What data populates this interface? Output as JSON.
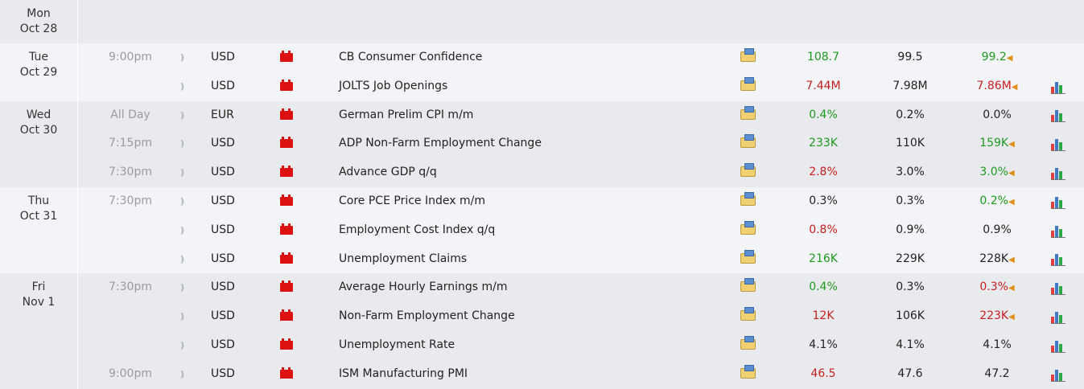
{
  "days": [
    {
      "day": "Mon",
      "date": "Oct 28",
      "events": []
    },
    {
      "day": "Tue",
      "date": "Oct 29",
      "events": [
        {
          "time": "9:00pm",
          "currency": "USD",
          "event": "CB Consumer Confidence",
          "actual": "108.7",
          "actual_color": "green",
          "forecast": "99.5",
          "previous": "99.2",
          "previous_color": "green",
          "revised": true,
          "chart": false
        },
        {
          "time": "",
          "currency": "USD",
          "event": "JOLTS Job Openings",
          "actual": "7.44M",
          "actual_color": "red",
          "forecast": "7.98M",
          "previous": "7.86M",
          "previous_color": "red",
          "revised": true,
          "chart": true
        }
      ]
    },
    {
      "day": "Wed",
      "date": "Oct 30",
      "events": [
        {
          "time": "All Day",
          "currency": "EUR",
          "event": "German Prelim CPI m/m",
          "actual": "0.4%",
          "actual_color": "green",
          "forecast": "0.2%",
          "previous": "0.0%",
          "previous_color": "dark",
          "revised": false,
          "chart": true
        },
        {
          "time": "7:15pm",
          "currency": "USD",
          "event": "ADP Non-Farm Employment Change",
          "actual": "233K",
          "actual_color": "green",
          "forecast": "110K",
          "previous": "159K",
          "previous_color": "green",
          "revised": true,
          "chart": true
        },
        {
          "time": "7:30pm",
          "currency": "USD",
          "event": "Advance GDP q/q",
          "actual": "2.8%",
          "actual_color": "red",
          "forecast": "3.0%",
          "previous": "3.0%",
          "previous_color": "green",
          "revised": true,
          "chart": true
        }
      ]
    },
    {
      "day": "Thu",
      "date": "Oct 31",
      "events": [
        {
          "time": "7:30pm",
          "currency": "USD",
          "event": "Core PCE Price Index m/m",
          "actual": "0.3%",
          "actual_color": "dark",
          "forecast": "0.3%",
          "previous": "0.2%",
          "previous_color": "green",
          "revised": true,
          "chart": true
        },
        {
          "time": "",
          "currency": "USD",
          "event": "Employment Cost Index q/q",
          "actual": "0.8%",
          "actual_color": "red",
          "forecast": "0.9%",
          "previous": "0.9%",
          "previous_color": "dark",
          "revised": false,
          "chart": true
        },
        {
          "time": "",
          "currency": "USD",
          "event": "Unemployment Claims",
          "actual": "216K",
          "actual_color": "green",
          "forecast": "229K",
          "previous": "228K",
          "previous_color": "dark",
          "revised": true,
          "chart": true
        }
      ]
    },
    {
      "day": "Fri",
      "date": "Nov 1",
      "events": [
        {
          "time": "7:30pm",
          "currency": "USD",
          "event": "Average Hourly Earnings m/m",
          "actual": "0.4%",
          "actual_color": "green",
          "forecast": "0.3%",
          "previous": "0.3%",
          "previous_color": "red",
          "revised": true,
          "chart": true
        },
        {
          "time": "",
          "currency": "USD",
          "event": "Non-Farm Employment Change",
          "actual": "12K",
          "actual_color": "red",
          "forecast": "106K",
          "previous": "223K",
          "previous_color": "red",
          "revised": true,
          "chart": true
        },
        {
          "time": "",
          "currency": "USD",
          "event": "Unemployment Rate",
          "actual": "4.1%",
          "actual_color": "dark",
          "forecast": "4.1%",
          "previous": "4.1%",
          "previous_color": "dark",
          "revised": false,
          "chart": true
        },
        {
          "time": "9:00pm",
          "currency": "USD",
          "event": "ISM Manufacturing PMI",
          "actual": "46.5",
          "actual_color": "red",
          "forecast": "47.6",
          "previous": "47.2",
          "previous_color": "dark",
          "revised": false,
          "chart": true
        }
      ]
    }
  ],
  "icons": {
    "impact": "impact-icon",
    "flag": "currency-flag-icon",
    "detail": "detail-folder-icon",
    "revised": "revised-marker-icon",
    "chart": "chart-icon"
  }
}
